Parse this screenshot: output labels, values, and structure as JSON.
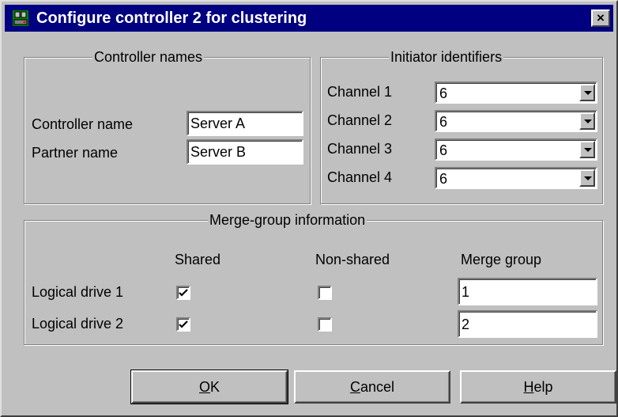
{
  "window": {
    "title": "Configure controller 2 for clustering",
    "close_label": "×"
  },
  "controller_names": {
    "legend": "Controller names",
    "controller_label": "Controller name",
    "controller_value": "Server A",
    "partner_label": "Partner name",
    "partner_value": "Server B"
  },
  "initiators": {
    "legend": "Initiator identifiers",
    "channels": [
      {
        "label": "Channel 1",
        "value": "6"
      },
      {
        "label": "Channel 2",
        "value": "6"
      },
      {
        "label": "Channel 3",
        "value": "6"
      },
      {
        "label": "Channel 4",
        "value": "6"
      }
    ]
  },
  "merge": {
    "legend": "Merge-group information",
    "col_shared": "Shared",
    "col_nonshared": "Non-shared",
    "col_group": "Merge group",
    "drives": [
      {
        "label": "Logical drive 1",
        "shared": true,
        "nonshared": false,
        "group": "1"
      },
      {
        "label": "Logical drive 2",
        "shared": true,
        "nonshared": false,
        "group": "2"
      }
    ]
  },
  "buttons": {
    "ok": {
      "mnemonic": "O",
      "rest": "K"
    },
    "cancel": {
      "mnemonic": "C",
      "rest": "ancel"
    },
    "help": {
      "mnemonic": "H",
      "rest": "elp"
    }
  }
}
